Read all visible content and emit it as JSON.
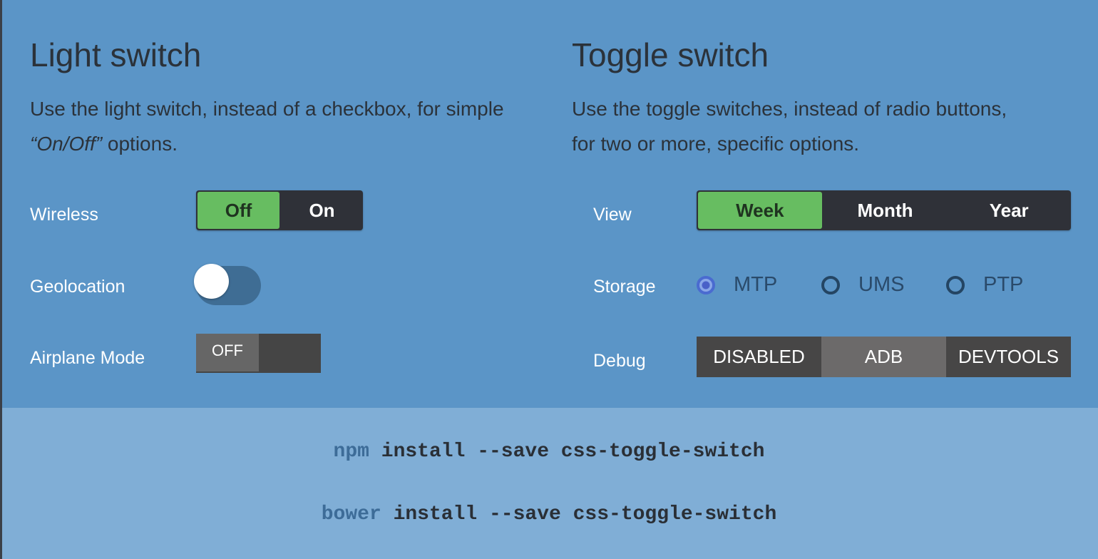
{
  "light": {
    "title": "Light switch",
    "desc_pre": "Use the light switch, instead of a checkbox, for simple ",
    "desc_em": "“On/Off”",
    "desc_post": " options.",
    "wireless": {
      "label": "Wireless",
      "options": [
        "Off",
        "On"
      ],
      "selected": "Off"
    },
    "geolocation": {
      "label": "Geolocation",
      "checked": false
    },
    "airplane": {
      "label": "Airplane Mode",
      "state": "OFF"
    }
  },
  "toggle": {
    "title": "Toggle switch",
    "desc": "Use the toggle switches, instead of radio buttons, for two or more, specific options.",
    "view": {
      "label": "View",
      "options": [
        "Week",
        "Month",
        "Year"
      ],
      "selected": "Week"
    },
    "storage": {
      "label": "Storage",
      "options": [
        "MTP",
        "UMS",
        "PTP"
      ],
      "selected": "MTP"
    },
    "debug": {
      "label": "Debug",
      "options": [
        "DISABLED",
        "ADB",
        "DEVTOOLS"
      ],
      "selected": "ADB"
    }
  },
  "install": {
    "npm": {
      "pm": "npm",
      "cmd": "install --save css-toggle-switch"
    },
    "bower": {
      "pm": "bower",
      "cmd": "install --save css-toggle-switch"
    }
  },
  "colors": {
    "background": "#5b95c7",
    "footer": "#80aed6",
    "active": "#67bd61",
    "radio_selected": "#4a6bd0"
  }
}
